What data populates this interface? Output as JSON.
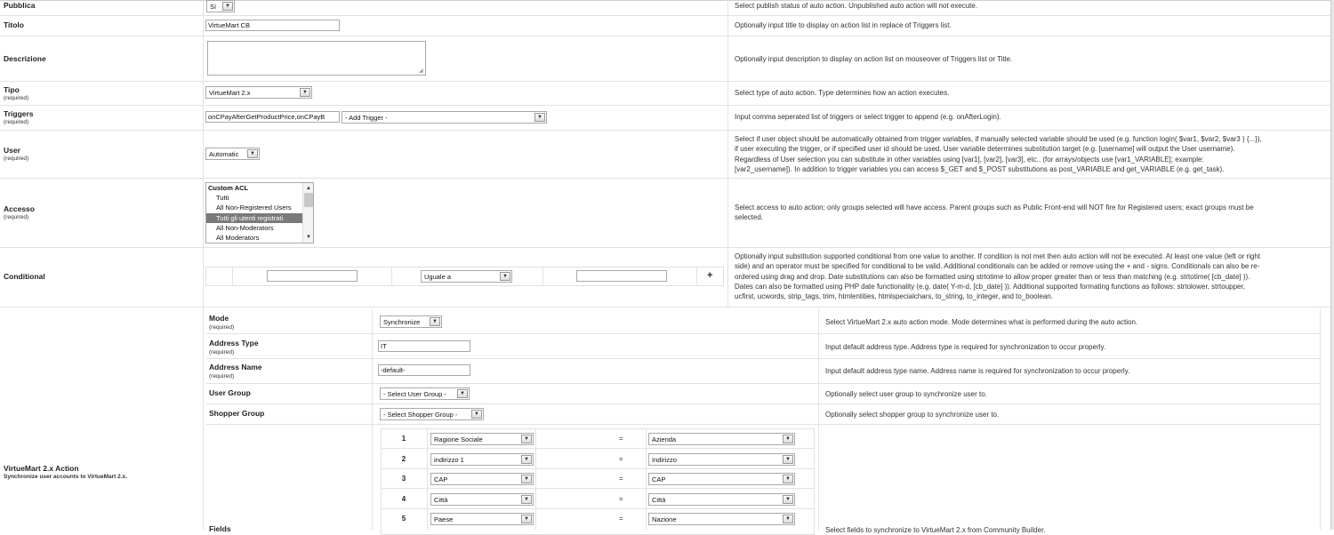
{
  "rows": {
    "pubblica": {
      "label": "Pubblica",
      "value": "Sì",
      "desc": "Select publish status of auto action. Unpublished auto action will not execute."
    },
    "titolo": {
      "label": "Titolo",
      "value": "VirtueMart CB",
      "desc": "Optionally input title to display on action list in replace of Triggers list."
    },
    "descrizione": {
      "label": "Descrizione",
      "value": "",
      "desc": "Optionally input description to display on action list on mouseover of Triggers list or Title."
    },
    "tipo": {
      "label": "Tipo",
      "required": "(required)",
      "value": "VirtueMart 2.x",
      "desc": "Select type of auto action. Type determines how an action executes."
    },
    "triggers": {
      "label": "Triggers",
      "required": "(required)",
      "value": "onCPayAfterGetProductPrice,onCPayB",
      "add_trigger": "- Add Trigger -",
      "desc": "Input comma seperated list of triggers or select trigger to append (e.g. onAfterLogin)."
    },
    "user": {
      "label": "User",
      "required": "(required)",
      "value": "Automatic",
      "desc": [
        "Select if user object should be automatically obtained from trigger variables, if manually selected variable should be used (e.g. function login( $var1, $var2, $var3 ) {...}),",
        "if user executing the trigger, or if specified user id should be used. User variable determines substitution target (e.g. [username] will output the User username).",
        "Regardless of User selection you can substitute in other variables using [var1], [var2], [var3], etc.. (for arrays/objects use [var1_VARIABLE]; example:",
        "[var2_username]). In addition to trigger variables you can access $_GET and $_POST substitutions as post_VARIABLE and get_VARIABLE (e.g. get_task)."
      ]
    },
    "accesso": {
      "label": "Accesso",
      "required": "(required)",
      "options": [
        "Custom ACL",
        "Tutti",
        "All Non-Registered Users",
        "Tutti gli utenti registrati",
        "All Non-Moderators",
        "All Moderators"
      ],
      "desc": [
        "Select access to auto action; only groups selected will have access. Parent groups such as Public Front-end will NOT fire for Registered users; exact groups must be",
        "selected."
      ]
    },
    "conditional": {
      "label": "Conditional",
      "left": "",
      "operator": "Uguale a",
      "right": "",
      "plus": "+",
      "desc": [
        "Optionally input substitution supported conditional from one value to another. If condition is not met then auto action will not be executed. At least one value (left or right",
        "side) and an operator must be specified for conditional to be valid. Additional conditionals can be added or remove using the + and - signs. Conditionals can also be re-",
        "ordered using drag and drop. Date substitutions can also be formatted using strtotime to allow proper greater than or less than matching (e.g. strtotime( [cb_date] )).",
        "Dates can also be formatted using PHP date functionality (e.g. date( Y-m-d, [cb_date] )). Additional supported formating functions as follows: strtolower, strtoupper,",
        "ucfirst, ucwords, strip_tags, trim, htmlentities, htmlspecialchars, to_string, to_integer, and to_boolean."
      ]
    }
  },
  "action": {
    "label": "VirtueMart 2.x Action",
    "sublabel": "Synchronize user accounts to VirtueMart 2.x.",
    "mode": {
      "label": "Mode",
      "required": "(required)",
      "value": "Synchronize",
      "desc": "Select VirtueMart 2.x auto action mode. Mode determines what is performed during the auto action."
    },
    "address_type": {
      "label": "Address Type",
      "required": "(required)",
      "value": "IT",
      "desc": "Input default address type. Address type is required for synchronization to occur properly."
    },
    "address_name": {
      "label": "Address Name",
      "required": "(required)",
      "value": "-default-",
      "desc": "Input default address type name. Address name is required for synchronization to occur properly."
    },
    "user_group": {
      "label": "User Group",
      "value": "- Select User Group -",
      "desc": "Optionally select user group to synchronize user to."
    },
    "shopper_group": {
      "label": "Shopper Group",
      "value": "- Select Shopper Group -",
      "desc": "Optionally select shopper group to synchronize user to."
    },
    "fields": {
      "label": "Fields",
      "desc": "Select fields to synchronize to VirtueMart 2.x from Community Builder.",
      "rows": [
        {
          "num": "1",
          "cb": "Ragione Sociale",
          "eq": "=",
          "vm": "Azienda"
        },
        {
          "num": "2",
          "cb": "indirizzo 1",
          "eq": "=",
          "vm": "Indirizzo"
        },
        {
          "num": "3",
          "cb": "CAP",
          "eq": "=",
          "vm": "CAP"
        },
        {
          "num": "4",
          "cb": "Città",
          "eq": "=",
          "vm": "Città"
        },
        {
          "num": "5",
          "cb": "Paese",
          "eq": "=",
          "vm": "Nazione"
        }
      ]
    }
  }
}
